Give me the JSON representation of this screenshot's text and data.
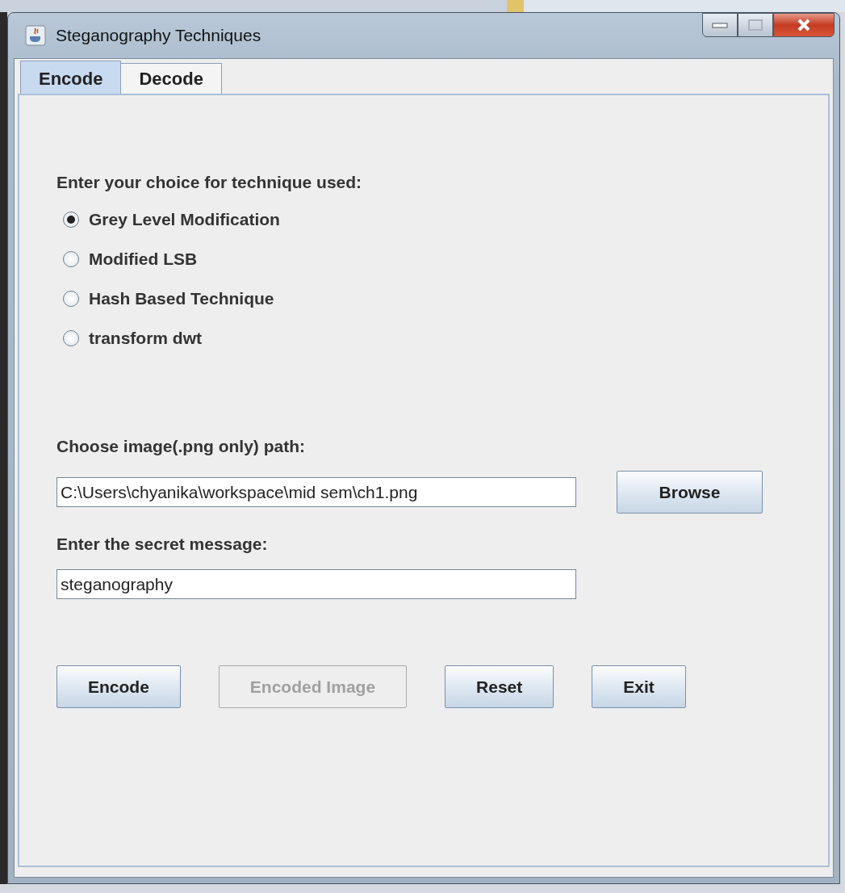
{
  "window": {
    "title": "Steganography Techniques"
  },
  "tabs": [
    {
      "label": "Encode",
      "selected": true
    },
    {
      "label": "Decode",
      "selected": false
    }
  ],
  "technique_label": "Enter your choice for technique used:",
  "techniques": [
    {
      "label": "Grey Level Modification",
      "selected": true
    },
    {
      "label": "Modified LSB",
      "selected": false
    },
    {
      "label": "Hash Based Technique",
      "selected": false
    },
    {
      "label": "transform dwt",
      "selected": false
    }
  ],
  "path_label": "Choose image(.png only) path:",
  "path_field": {
    "value": "C:\\Users\\chyanika\\workspace\\mid sem\\ch1.png"
  },
  "browse_button": "Browse",
  "message_label": "Enter the secret message:",
  "message_field": {
    "value": "steganography"
  },
  "buttons": [
    {
      "label": "Encode",
      "disabled": false
    },
    {
      "label": "Encoded Image",
      "disabled": true
    },
    {
      "label": "Reset",
      "disabled": false
    },
    {
      "label": "Exit",
      "disabled": false
    }
  ]
}
